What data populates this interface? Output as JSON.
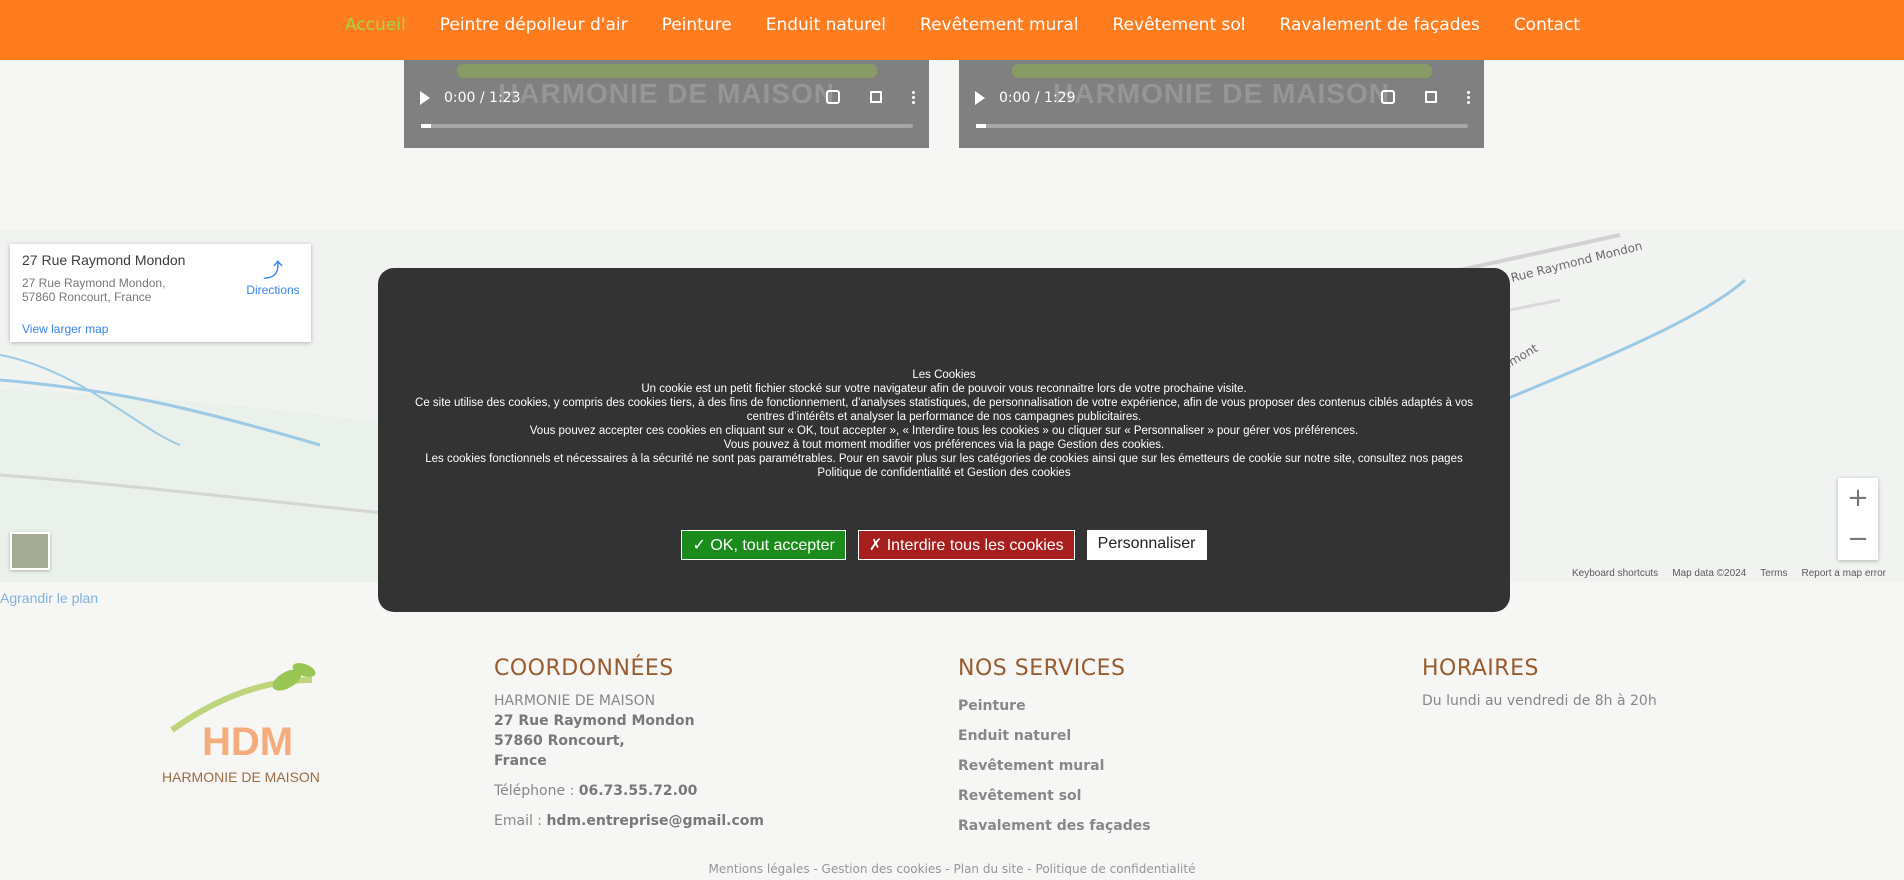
{
  "nav": {
    "items": [
      {
        "label": "Accueil",
        "active": true
      },
      {
        "label": "Peintre dépolleur d'air"
      },
      {
        "label": "Peinture"
      },
      {
        "label": "Enduit naturel"
      },
      {
        "label": "Revêtement mural"
      },
      {
        "label": "Revêtement sol"
      },
      {
        "label": "Ravalement de façades"
      },
      {
        "label": "Contact"
      }
    ],
    "bg_color": "#ff6a00",
    "active_color": "#9acd32"
  },
  "videos": [
    {
      "watermark": "HARMONIE DE MAISON",
      "time": "0:00 / 1:23"
    },
    {
      "watermark": "HARMONIE DE MAISON",
      "time": "0:00 / 1:29"
    }
  ],
  "map": {
    "card_title": "27 Rue Raymond Mondon",
    "card_address": "27 Rue Raymond Mondon, 57860 Roncourt, France",
    "directions": "Directions",
    "view_larger": "View larger map",
    "street_label_1": "Rue Raymond Mondon",
    "street_label_2": "umont",
    "zoom_in": "+",
    "zoom_out": "−",
    "attribution": [
      "Keyboard shortcuts",
      "Map data ©2024",
      "Terms",
      "Report a map error"
    ],
    "agrandir": "Agrandir le plan"
  },
  "cookie": {
    "title": "Les Cookies",
    "lines": [
      "Un cookie est un petit fichier stocké sur votre navigateur afin de pouvoir vous reconnaitre lors de votre prochaine visite.",
      "Ce site utilise des cookies, y compris des cookies tiers, à des fins de fonctionnement, d’analyses statistiques, de personnalisation de votre expérience, afin de vous proposer des contenus ciblés adaptés à vos centres d’intérêts et analyser la performance de nos campagnes publicitaires.",
      "Vous pouvez accepter ces cookies en cliquant sur « OK, tout accepter », «  Interdire tous les cookies  » ou cliquer sur « Personnaliser » pour gérer vos préférences.",
      "Vous pouvez à tout moment modifier vos préférences via la page Gestion des cookies.",
      "Les cookies fonctionnels et nécessaires à la sécurité ne sont pas paramétrables. Pour en savoir plus sur les catégories de cookies ainsi que sur les émetteurs de cookie sur notre site, consultez nos pages Politique de confidentialité et Gestion des cookies"
    ],
    "btn_accept": "✓ OK, tout accepter",
    "btn_deny": "✗ Interdire tous les cookies",
    "btn_custom": "Personnaliser"
  },
  "footer": {
    "logo_text": "HDM",
    "logo_sub": "HARMONIE DE MAISON",
    "coords": {
      "title": "COORDONNÉES",
      "company": "HARMONIE DE MAISON",
      "street": "27 Rue Raymond Mondon",
      "city": "57860 Roncourt,",
      "country": "France",
      "phone_label": "Téléphone :",
      "phone": "06.73.55.72.00",
      "email_label": "Email :",
      "email": "hdm.entreprise@gmail.com"
    },
    "services": {
      "title": "NOS SERVICES",
      "items": [
        "Peinture",
        "Enduit naturel",
        "Revêtement mural",
        "Revêtement sol",
        "Ravalement des façades"
      ]
    },
    "hours": {
      "title": "HORAIRES",
      "text": "Du lundi au vendredi de 8h à 20h"
    },
    "bottom_links": "Mentions légales - Gestion des cookies - Plan du site - Politique de confidentialité"
  }
}
